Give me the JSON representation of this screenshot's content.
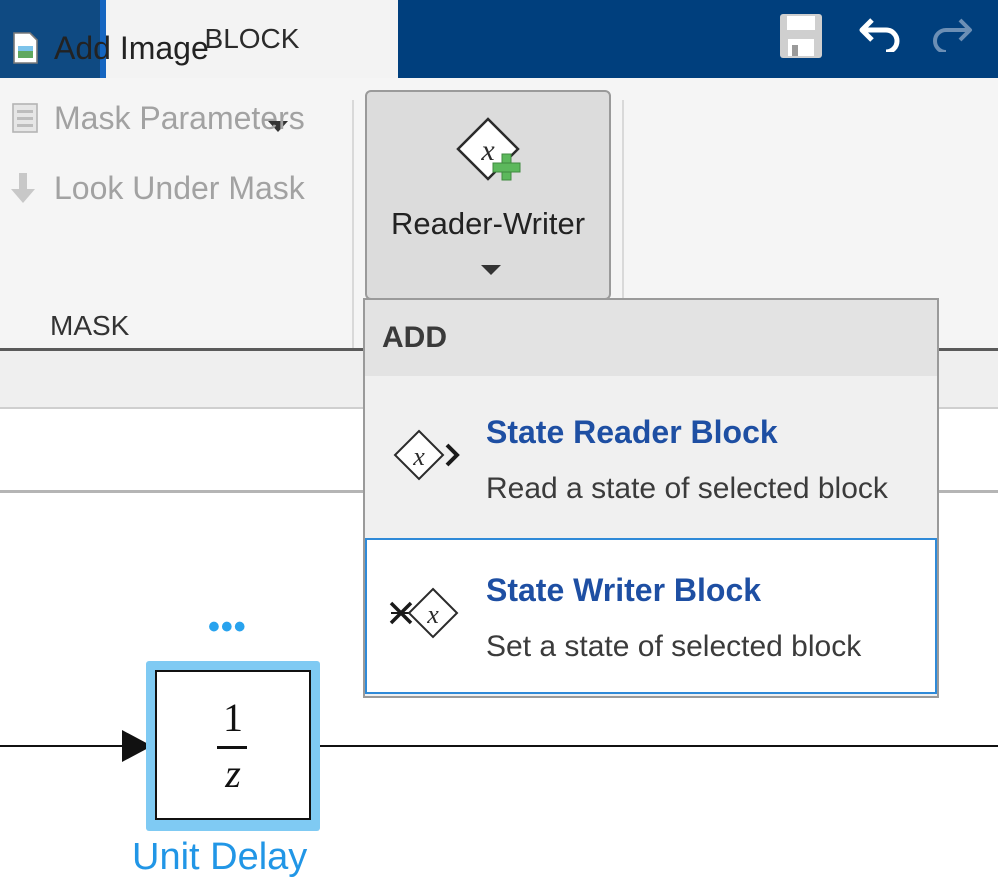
{
  "toolstrip": {
    "active_tab": "BLOCK",
    "quick_access": {
      "save": "save-icon",
      "undo": "undo-icon",
      "redo": "redo-icon"
    }
  },
  "ribbon": {
    "mask_group": {
      "items": [
        {
          "label": "Add Image",
          "icon": "add-image-icon",
          "enabled": true,
          "has_dropdown": true
        },
        {
          "label": "Mask Parameters",
          "icon": "mask-parameters-icon",
          "enabled": false
        },
        {
          "label": "Look Under Mask",
          "icon": "look-under-mask-icon",
          "enabled": false
        }
      ],
      "group_label": "MASK"
    },
    "reader_writer_button": {
      "label": "Reader-Writer",
      "icon": "reader-writer-add-icon"
    }
  },
  "dropdown_menu": {
    "section_header": "ADD",
    "items": [
      {
        "title": "State Reader Block",
        "description": "Read a state of selected block",
        "icon": "state-reader-icon",
        "highlighted": false
      },
      {
        "title": "State Writer Block",
        "description": "Set a state of selected block",
        "icon": "state-writer-icon",
        "highlighted": true
      }
    ]
  },
  "canvas": {
    "block": {
      "name": "Unit Delay",
      "numerator": "1",
      "denominator": "z",
      "ellipsis": "•••",
      "selected": true
    }
  },
  "colors": {
    "header_blue": "#003f7d",
    "tab_accent": "#1565c0",
    "menu_title": "#1e4fa3",
    "selection": "#7fcaf3",
    "block_name": "#2196e6"
  }
}
